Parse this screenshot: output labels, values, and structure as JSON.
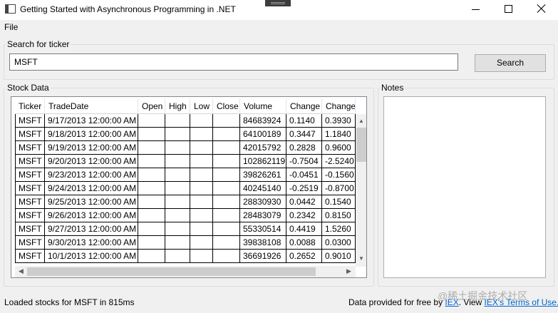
{
  "window": {
    "title": "Getting Started with Asynchronous Programming in .NET"
  },
  "menu": {
    "file": "File"
  },
  "search": {
    "group_label": "Search for ticker",
    "value": "MSFT",
    "button_label": "Search"
  },
  "stock": {
    "group_label": "Stock Data",
    "columns": [
      "Ticker",
      "TradeDate",
      "Open",
      "High",
      "Low",
      "Close",
      "Volume",
      "Change",
      "Change"
    ],
    "rows": [
      [
        "MSFT",
        "9/17/2013 12:00:00 AM",
        "",
        "",
        "",
        "",
        "84683924",
        "0.1140",
        "0.3930"
      ],
      [
        "MSFT",
        "9/18/2013 12:00:00 AM",
        "",
        "",
        "",
        "",
        "64100189",
        "0.3447",
        "1.1840"
      ],
      [
        "MSFT",
        "9/19/2013 12:00:00 AM",
        "",
        "",
        "",
        "",
        "42015792",
        "0.2828",
        "0.9600"
      ],
      [
        "MSFT",
        "9/20/2013 12:00:00 AM",
        "",
        "",
        "",
        "",
        "102862119",
        "-0.7504",
        "-2.5240"
      ],
      [
        "MSFT",
        "9/23/2013 12:00:00 AM",
        "",
        "",
        "",
        "",
        "39826261",
        "-0.0451",
        "-0.1560"
      ],
      [
        "MSFT",
        "9/24/2013 12:00:00 AM",
        "",
        "",
        "",
        "",
        "40245140",
        "-0.2519",
        "-0.8700"
      ],
      [
        "MSFT",
        "9/25/2013 12:00:00 AM",
        "",
        "",
        "",
        "",
        "28830930",
        "0.0442",
        "0.1540"
      ],
      [
        "MSFT",
        "9/26/2013 12:00:00 AM",
        "",
        "",
        "",
        "",
        "28483079",
        "0.2342",
        "0.8150"
      ],
      [
        "MSFT",
        "9/27/2013 12:00:00 AM",
        "",
        "",
        "",
        "",
        "55330514",
        "0.4419",
        "1.5260"
      ],
      [
        "MSFT",
        "9/30/2013 12:00:00 AM",
        "",
        "",
        "",
        "",
        "39838108",
        "0.0088",
        "0.0300"
      ],
      [
        "MSFT",
        "10/1/2013 12:00:00 AM",
        "",
        "",
        "",
        "",
        "36691926",
        "0.2652",
        "0.9010"
      ]
    ]
  },
  "notes": {
    "group_label": "Notes"
  },
  "status": {
    "left_text": "Loaded stocks for MSFT in 815ms",
    "right_prefix": "Data provided for free by ",
    "iex_link": "IEX",
    "right_mid": ". View ",
    "terms_link": "IEX's Terms of Use."
  },
  "watermark": "@稀土掘金技术社区",
  "icons": {
    "app": "app-window-icon",
    "minimize": "minimize-icon",
    "maximize": "maximize-icon",
    "close": "close-icon"
  }
}
